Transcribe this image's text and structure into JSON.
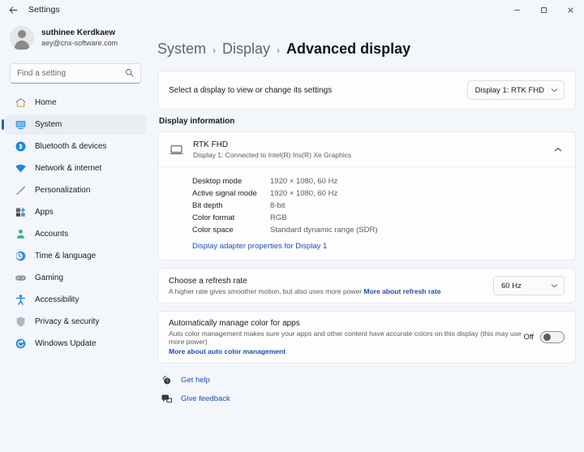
{
  "window": {
    "app_title": "Settings",
    "back_icon": "back-arrow-icon",
    "controls": {
      "minimize": "–",
      "maximize": "☐",
      "close": "✕"
    }
  },
  "sidebar": {
    "account": {
      "name": "suthinee Kerdkaew",
      "email": "aey@cnx-software.com"
    },
    "search": {
      "placeholder": "Find a setting",
      "value": "",
      "icon": "search-icon"
    },
    "items": [
      {
        "label": "Home",
        "icon": "home-icon",
        "active": false
      },
      {
        "label": "System",
        "icon": "system-monitor-icon",
        "active": true
      },
      {
        "label": "Bluetooth & devices",
        "icon": "bluetooth-icon",
        "active": false
      },
      {
        "label": "Network & internet",
        "icon": "wifi-icon",
        "active": false
      },
      {
        "label": "Personalization",
        "icon": "paintbrush-icon",
        "active": false
      },
      {
        "label": "Apps",
        "icon": "apps-icon",
        "active": false
      },
      {
        "label": "Accounts",
        "icon": "person-icon",
        "active": false
      },
      {
        "label": "Time & language",
        "icon": "clock-globe-icon",
        "active": false
      },
      {
        "label": "Gaming",
        "icon": "gamepad-icon",
        "active": false
      },
      {
        "label": "Accessibility",
        "icon": "accessibility-person-icon",
        "active": false
      },
      {
        "label": "Privacy & security",
        "icon": "shield-icon",
        "active": false
      },
      {
        "label": "Windows Update",
        "icon": "update-refresh-icon",
        "active": false
      }
    ]
  },
  "main": {
    "breadcrumb": {
      "first": "System",
      "sep1": "›",
      "second": "Display",
      "sep2": "›",
      "current": "Advanced display"
    },
    "display_select": {
      "label": "Select a display to view or change its settings",
      "dropdown_value": "Display 1: RTK FHD",
      "chevron": "⌄"
    },
    "display_information": {
      "section_title": "Display information",
      "display_name": "RTK FHD",
      "display_subtitle": "Display 1: Connected to Intel(R) Iris(R) Xe Graphics",
      "monitor_icon": "monitor-icon",
      "expand_chevron": "⌃",
      "rows": [
        {
          "key": "Desktop mode",
          "value": "1920 × 1080, 60 Hz"
        },
        {
          "key": "Active signal mode",
          "value": "1920 × 1080, 60 Hz"
        },
        {
          "key": "Bit depth",
          "value": "8-bit"
        },
        {
          "key": "Color format",
          "value": "RGB"
        },
        {
          "key": "Color space",
          "value": "Standard dynamic range (SDR)"
        }
      ],
      "adapter_link": "Display adapter properties for Display 1"
    },
    "refresh_rate": {
      "title": "Choose a refresh rate",
      "description": "A higher rate gives smoother motion, but also uses more power",
      "link": "More about refresh rate",
      "dropdown_value": "60 Hz",
      "chevron": "⌄"
    },
    "auto_color": {
      "title": "Automatically manage color for apps",
      "description": "Auto color management makes sure your apps and other content have accurate colors on this display (this may use more power)",
      "link": "More about auto color management",
      "toggle_state": "Off"
    },
    "footer": {
      "get_help": "Get help",
      "get_help_icon": "help-question-icon",
      "give_feedback": "Give feedback",
      "give_feedback_icon": "feedback-icon"
    }
  },
  "colors": {
    "accent": "#0f6cbd",
    "link": "#1c4fb0",
    "page_bg": "#f3f6fb",
    "card_bg": "#fdfdfd"
  }
}
